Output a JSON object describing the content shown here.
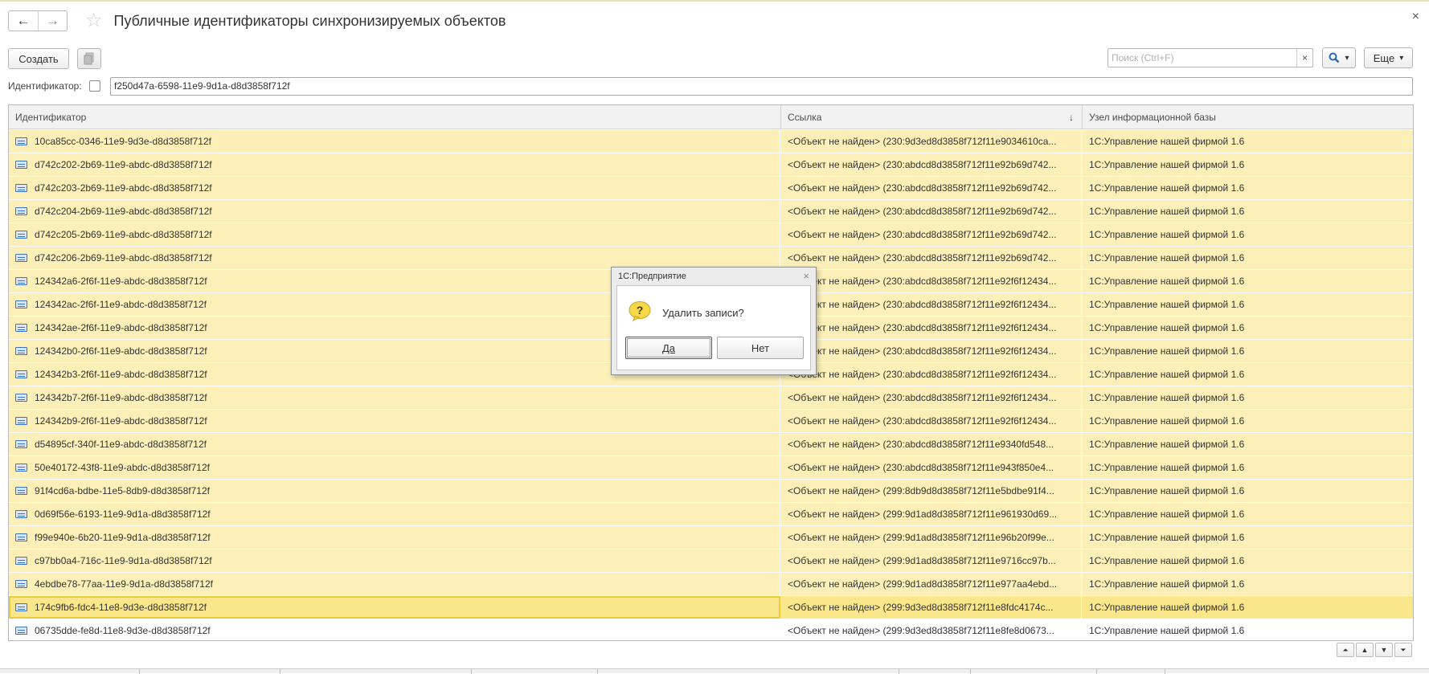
{
  "window": {
    "title": "Публичные идентификаторы синхронизируемых объектов",
    "back_icon": "←",
    "forward_icon": "→",
    "star_icon": "☆",
    "close_icon": "×"
  },
  "toolbar": {
    "create_label": "Создать",
    "search_placeholder": "Поиск (Ctrl+F)",
    "search_clear": "×",
    "search_icon": "🔍",
    "dropdown_icon": "▾",
    "more_label": "Еще"
  },
  "filter": {
    "label": "Идентификатор:",
    "value": "f250d47a-6598-11e9-9d1a-d8d3858f712f"
  },
  "table": {
    "columns": [
      "Идентификатор",
      "Ссылка",
      "Узел информационной базы"
    ],
    "sort_icon": "↓",
    "rows": [
      [
        "10ca85cc-0346-11e9-9d3e-d8d3858f712f",
        "<Объект не найден> (230:9d3ed8d3858f712f11e9034610ca...",
        "1С:Управление нашей фирмой 1.6"
      ],
      [
        "d742c202-2b69-11e9-abdc-d8d3858f712f",
        "<Объект не найден> (230:abdcd8d3858f712f11e92b69d742...",
        "1С:Управление нашей фирмой 1.6"
      ],
      [
        "d742c203-2b69-11e9-abdc-d8d3858f712f",
        "<Объект не найден> (230:abdcd8d3858f712f11e92b69d742...",
        "1С:Управление нашей фирмой 1.6"
      ],
      [
        "d742c204-2b69-11e9-abdc-d8d3858f712f",
        "<Объект не найден> (230:abdcd8d3858f712f11e92b69d742...",
        "1С:Управление нашей фирмой 1.6"
      ],
      [
        "d742c205-2b69-11e9-abdc-d8d3858f712f",
        "<Объект не найден> (230:abdcd8d3858f712f11e92b69d742...",
        "1С:Управление нашей фирмой 1.6"
      ],
      [
        "d742c206-2b69-11e9-abdc-d8d3858f712f",
        "<Объект не найден> (230:abdcd8d3858f712f11e92b69d742...",
        "1С:Управление нашей фирмой 1.6"
      ],
      [
        "124342a6-2f6f-11e9-abdc-d8d3858f712f",
        "<Объект не найден> (230:abdcd8d3858f712f11e92f6f12434...",
        "1С:Управление нашей фирмой 1.6"
      ],
      [
        "124342ac-2f6f-11e9-abdc-d8d3858f712f",
        "<Объект не найден> (230:abdcd8d3858f712f11e92f6f12434...",
        "1С:Управление нашей фирмой 1.6"
      ],
      [
        "124342ae-2f6f-11e9-abdc-d8d3858f712f",
        "<Объект не найден> (230:abdcd8d3858f712f11e92f6f12434...",
        "1С:Управление нашей фирмой 1.6"
      ],
      [
        "124342b0-2f6f-11e9-abdc-d8d3858f712f",
        "<Объект не найден> (230:abdcd8d3858f712f11e92f6f12434...",
        "1С:Управление нашей фирмой 1.6"
      ],
      [
        "124342b3-2f6f-11e9-abdc-d8d3858f712f",
        "<Объект не найден> (230:abdcd8d3858f712f11e92f6f12434...",
        "1С:Управление нашей фирмой 1.6"
      ],
      [
        "124342b7-2f6f-11e9-abdc-d8d3858f712f",
        "<Объект не найден> (230:abdcd8d3858f712f11e92f6f12434...",
        "1С:Управление нашей фирмой 1.6"
      ],
      [
        "124342b9-2f6f-11e9-abdc-d8d3858f712f",
        "<Объект не найден> (230:abdcd8d3858f712f11e92f6f12434...",
        "1С:Управление нашей фирмой 1.6"
      ],
      [
        "d54895cf-340f-11e9-abdc-d8d3858f712f",
        "<Объект не найден> (230:abdcd8d3858f712f11e9340fd548...",
        "1С:Управление нашей фирмой 1.6"
      ],
      [
        "50e40172-43f8-11e9-abdc-d8d3858f712f",
        "<Объект не найден> (230:abdcd8d3858f712f11e943f850e4...",
        "1С:Управление нашей фирмой 1.6"
      ],
      [
        "91f4cd6a-bdbe-11e5-8db9-d8d3858f712f",
        "<Объект не найден> (299:8db9d8d3858f712f11e5bdbe91f4...",
        "1С:Управление нашей фирмой 1.6"
      ],
      [
        "0d69f56e-6193-11e9-9d1a-d8d3858f712f",
        "<Объект не найден> (299:9d1ad8d3858f712f11e961930d69...",
        "1С:Управление нашей фирмой 1.6"
      ],
      [
        "f99e940e-6b20-11e9-9d1a-d8d3858f712f",
        "<Объект не найден> (299:9d1ad8d3858f712f11e96b20f99e...",
        "1С:Управление нашей фирмой 1.6"
      ],
      [
        "c97bb0a4-716c-11e9-9d1a-d8d3858f712f",
        "<Объект не найден> (299:9d1ad8d3858f712f11e9716cc97b...",
        "1С:Управление нашей фирмой 1.6"
      ],
      [
        "4ebdbe78-77aa-11e9-9d1a-d8d3858f712f",
        "<Объект не найден> (299:9d1ad8d3858f712f11e977aa4ebd...",
        "1С:Управление нашей фирмой 1.6"
      ],
      [
        "174c9fb6-fdc4-11e8-9d3e-d8d3858f712f",
        "<Объект не найден> (299:9d3ed8d3858f712f11e8fdc4174c...",
        "1С:Управление нашей фирмой 1.6"
      ],
      [
        "06735dde-fe8d-11e8-9d3e-d8d3858f712f",
        "<Объект не найден> (299:9d3ed8d3858f712f11e8fe8d0673...",
        "1С:Управление нашей фирмой 1.6"
      ]
    ],
    "selected_row": 20,
    "plain_row": 21
  },
  "scroll": {
    "first_icon": "⏶",
    "up_icon": "▲",
    "down_icon": "▼",
    "last_icon": "⏷"
  },
  "dialog": {
    "title": "1С:Предприятие",
    "close_icon": "×",
    "message": "Удалить записи?",
    "yes_label": "Да",
    "no_label": "Нет"
  },
  "colors": {
    "row_bg": "#fcf0b8",
    "row_selected_bg": "#fae68b",
    "accent_blue": "#3b74c4"
  }
}
